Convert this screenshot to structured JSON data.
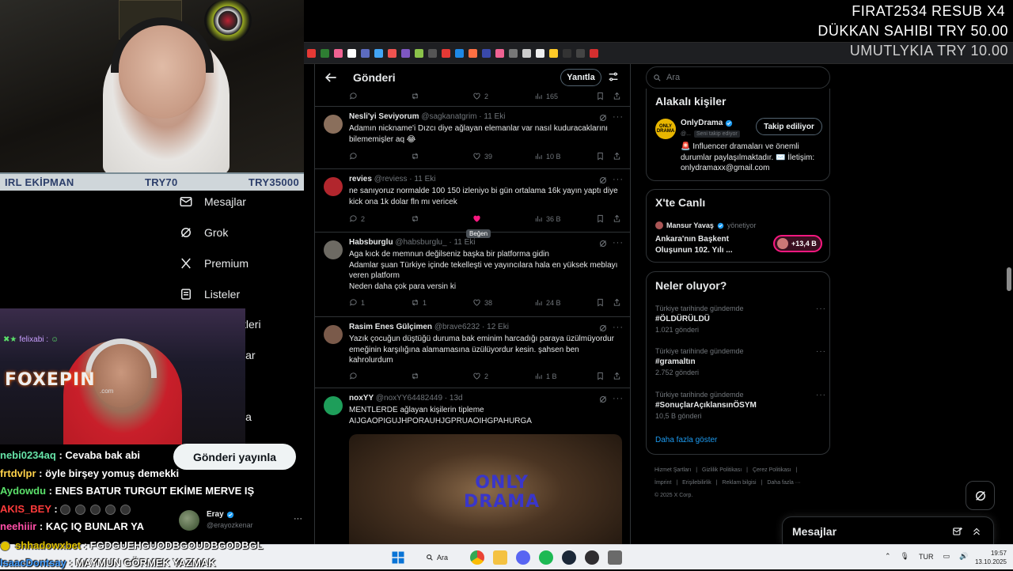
{
  "donations": [
    {
      "text": "FIRAT2534  RESUB X4"
    },
    {
      "text": "DÜKKAN SAHIBI  TRY 50.00"
    },
    {
      "text": "UMUTLYKIA  TRY 10.00"
    }
  ],
  "equipment": {
    "label": "IRL EKİPMAN",
    "current": "TRY70",
    "goal": "TRY35000"
  },
  "webcam": {
    "logo": "FOXEPIN",
    "logo_sub": ".com",
    "chat_user": "felixabi :"
  },
  "nav": [
    {
      "label": "Mesajlar",
      "icon": "mail-icon"
    },
    {
      "label": "Grok",
      "icon": "grok-icon"
    },
    {
      "label": "Premium",
      "icon": "x-logo-icon"
    },
    {
      "label": "Listeler",
      "icon": "list-icon"
    },
    {
      "label": "tleri"
    },
    {
      "label": "lar"
    },
    {
      "label": "la"
    }
  ],
  "post_button": "Gönderi yayınla",
  "profile": {
    "name": "Eray",
    "handle": "@erayozkenar",
    "more": "···"
  },
  "chat": [
    {
      "user": "nebi0234aq",
      "color": "#66e3a8",
      "msg": "Cevaba bak abi"
    },
    {
      "user": "frtdvlpr",
      "color": "#ffd24a",
      "msg": "öyle birşey yomuş demekki"
    },
    {
      "user": "Aydowdu",
      "color": "#5be06a",
      "msg": "ENES BATUR TURGUT EKİME MERVE IŞ"
    },
    {
      "user": "AKIS_BEY",
      "color": "#ff3b3b",
      "msg": "",
      "emotes": 5
    },
    {
      "user": "neehiiir",
      "color": "#ff4fa8",
      "msg": "KAÇ IQ BUNLAR YA"
    },
    {
      "user": "shhadowxbet",
      "color": "#e0c200",
      "msg": "FGDGUEHGUODBGOUDBGODBGL"
    },
    {
      "user": "IsaacDontsay",
      "color": "#47a0ff",
      "msg": "MAYMUN GÖRMEK YAZMAK"
    }
  ],
  "main": {
    "title": "Gönderi",
    "reply_label": "Yanıtla",
    "top_actions": {
      "retweets": "",
      "likes": "2",
      "views": "165"
    },
    "tweets": [
      {
        "name": "Nesli'yi Seviyorum",
        "handle": "@sagkanatgrim",
        "date": "11 Eki",
        "text": "Adamın nickname'i Dızcı diye ağlayan elemanlar var nasıl kuduracaklarını bilememişler aq 😂",
        "replies": "",
        "retweets": "",
        "likes": "39",
        "views": "10 B",
        "avatar": "#8a6f5c"
      },
      {
        "name": "revies",
        "handle": "@reviess",
        "date": "11 Eki",
        "text": "ne sanıyoruz normalde 100 150 izleniyo bi gün ortalama 16k yayın yaptı diye kick ona 1k dolar fln mı vericek",
        "replies": "2",
        "retweets": "",
        "likes": "",
        "views": "36 B",
        "avatar": "#b2262d"
      },
      {
        "name": "Habsburglu",
        "handle": "@habsburglu_",
        "date": "11 Eki",
        "text": "Aga kıck de memnun değilseniz başka bir platforma gidin\nAdamlar şuan Türkiye içinde tekelleşti ve yayıncılara hala en yüksek meblayı veren platform\nNeden daha çok para versin ki",
        "replies": "1",
        "retweets": "1",
        "likes": "38",
        "views": "24 B",
        "avatar": "#6d6a63"
      },
      {
        "name": "Rasim Enes Gülçimen",
        "handle": "@brave6232",
        "date": "12 Eki",
        "text": "Yazık çocuğun düştüğü duruma bak eminim harcadığı paraya üzülmüyordur emeğinin karşılığına alamamasına  üzülüyordur kesin. şahsen ben kahrolurdum",
        "replies": "",
        "retweets": "",
        "likes": "2",
        "views": "1 B",
        "avatar": "#7a5a4a"
      },
      {
        "name": "noxYY",
        "handle": "@noxYY64482449",
        "date": "13d",
        "text": "MENTLERDE ağlayan kişilerin tipleme\nAIJGAOPIGUJHPORAUHJGPRUAOIHGPAHURGA",
        "avatar": "#1e9e5a",
        "media_text": "ONLY\nDRAMA"
      }
    ],
    "tooltip": "Beğen"
  },
  "sidebar": {
    "search_placeholder": "Ara",
    "people_title": "Alakalı kişiler",
    "person": {
      "name": "OnlyDrama",
      "handle": "@...",
      "follows_you": "Seni takip ediyor",
      "follow_label": "Takip ediliyor",
      "bio": "🚨 Influencer dramaları ve önemli durumlar paylaşılmaktadır. ✉️ İletişim: onlydramaxx@gmail.com"
    },
    "live_title": "X'te Canlı",
    "live": {
      "host": "Mansur Yavaş",
      "role": "yönetiyor",
      "title": "Ankara'nın Başkent Oluşunun 102. Yılı ...",
      "count": "+13,4 B"
    },
    "trends_title": "Neler oluyor?",
    "trends": [
      {
        "category": "Türkiye tarihinde gündemde",
        "name": "#ÖLDÜRÜLDÜ",
        "count": "1.021 gönderi"
      },
      {
        "category": "Türkiye tarihinde gündemde",
        "name": "#gramaltın",
        "count": "2.752 gönderi"
      },
      {
        "category": "Türkiye tarihinde gündemde",
        "name": "#SonuçlarAçıklansınÖSYM",
        "count": "10,5 B gönderi"
      }
    ],
    "show_more": "Daha fazla göster",
    "footer": [
      "Hizmet Şartları",
      "|",
      "Gizlilik Politikası",
      "|",
      "Çerez Politikası",
      "|",
      "İmprint",
      "|",
      "Erişilebilirlik",
      "|",
      "Reklam bilgisi",
      "|",
      "Daha fazla ···",
      "© 2025 X Corp."
    ]
  },
  "messages_dock": {
    "title": "Mesajlar"
  },
  "taskbar": {
    "search": "Ara",
    "lang": "TUR",
    "time": "19:57",
    "date": "13.10.2025"
  },
  "colors": {
    "accent": "#1d9bf0",
    "like_active": "#f91880",
    "border": "#2f3336",
    "muted": "#71767b"
  }
}
